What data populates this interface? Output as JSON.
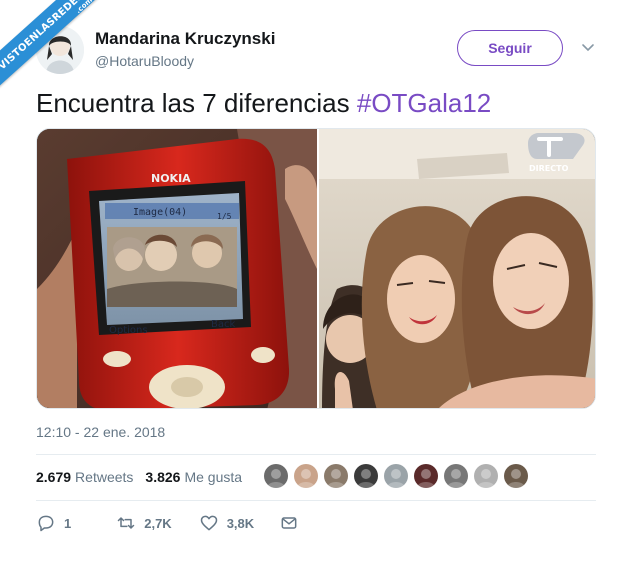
{
  "watermark": {
    "text": "VISTOENLASREDES",
    "suffix": ".com"
  },
  "author": {
    "name": "Mandarina Kruczynski",
    "handle": "@HotaruBloody"
  },
  "follow_label": "Seguir",
  "tweet": {
    "text_plain": "Encuentra las 7 diferencias ",
    "hashtag": "#OTGala12"
  },
  "media": {
    "left": {
      "brand": "NOKIA",
      "screen_title": "Image(04)",
      "screen_counter": "1/5",
      "softkey_left": "Options",
      "softkey_right": "Back"
    },
    "right": {
      "overlay_label": "DIRECTO"
    }
  },
  "timestamp": "12:10 - 22 ene. 2018",
  "stats": {
    "retweets_count": "2.679",
    "retweets_label": "Retweets",
    "likes_count": "3.826",
    "likes_label": "Me gusta"
  },
  "likers": [
    "#6b6b6b",
    "#c9a38a",
    "#8a7a6a",
    "#3b3b3b",
    "#9aa3a8",
    "#5a2a2a",
    "#777777",
    "#b0b0b0",
    "#6a5a4a"
  ],
  "actions": {
    "replies": "1",
    "retweets": "2,7K",
    "likes": "3,8K"
  },
  "colors": {
    "accent": "#794bc4",
    "muted": "#657786",
    "watermark": "#2b8fd6"
  }
}
